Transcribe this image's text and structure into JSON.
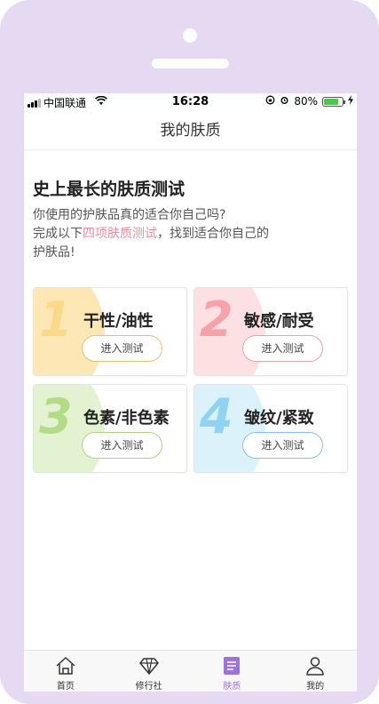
{
  "status_bar": {
    "carrier": "中国联通",
    "time": "16:28",
    "battery_percent": "80%",
    "battery_level": 0.8,
    "battery_color": "#3fcf3f"
  },
  "nav": {
    "title": "我的肤质"
  },
  "intro": {
    "title": "史上最长的肤质测试",
    "line1": "你使用的护肤品真的适合你自己吗?",
    "line2_prefix": "完成以下",
    "line2_highlight": "四项肤质测试",
    "line2_suffix": "，找到适合你自己的",
    "line3": "护肤品!",
    "highlight_color": "#f08a9c"
  },
  "cards": [
    {
      "number": "1",
      "label": "干性/油性",
      "button": "进入测试",
      "color": "#fcd98a",
      "blob": "#fde7b4",
      "btn_border": "#e9c170"
    },
    {
      "number": "2",
      "label": "敏感/耐受",
      "button": "进入测试",
      "color": "#f7a1a8",
      "blob": "#fde0e1",
      "btn_border": "#f2a0a5"
    },
    {
      "number": "3",
      "label": "色素/非色素",
      "button": "进入测试",
      "color": "#b2dc86",
      "blob": "#e3f3d2",
      "btn_border": "#a9d385"
    },
    {
      "number": "4",
      "label": "皱纹/紧致",
      "button": "进入测试",
      "color": "#8fd2f2",
      "blob": "#dcf2fb",
      "btn_border": "#82c5e6"
    }
  ],
  "tab_bar": {
    "items": [
      {
        "label": "首页",
        "icon": "home-icon"
      },
      {
        "label": "修行社",
        "icon": "diamond-icon"
      },
      {
        "label": "肤质",
        "icon": "document-icon"
      },
      {
        "label": "我的",
        "icon": "person-icon"
      }
    ],
    "active_index": 2,
    "active_color": "#9b73d9"
  }
}
